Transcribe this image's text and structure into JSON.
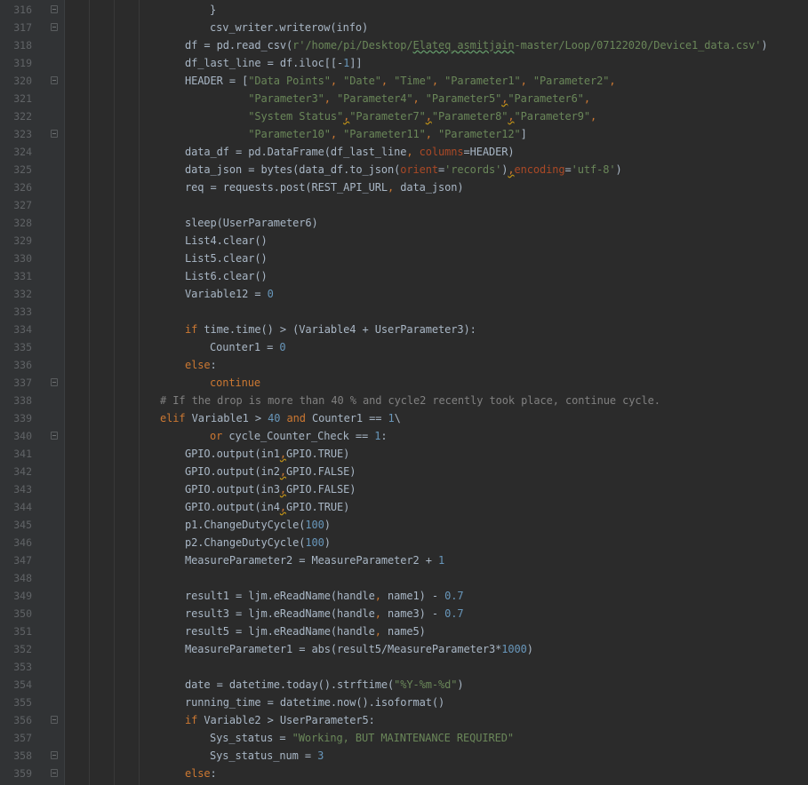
{
  "editor": {
    "language": "python",
    "lines": [
      {
        "n": "316",
        "indent": 2,
        "fold": true,
        "tokens": [
          [
            "}",
            "hl"
          ]
        ]
      },
      {
        "n": "317",
        "indent": 2,
        "fold": true,
        "tokens": [
          [
            "csv_writer.writerow(info)",
            "hl"
          ]
        ]
      },
      {
        "n": "318",
        "indent": 1,
        "fold": false,
        "tokens": [
          [
            "df = pd.read_csv(",
            "hl"
          ],
          [
            "r'/home/pi/Desktop/",
            "str"
          ],
          [
            "Elateq_asmitjain",
            "str typo"
          ],
          [
            "-master/Loop/07122020/Device1_data.csv'",
            "str"
          ],
          [
            ")",
            "hl"
          ]
        ]
      },
      {
        "n": "319",
        "indent": 1,
        "fold": false,
        "tokens": [
          [
            "df_last_line = df.iloc[[-",
            "hl"
          ],
          [
            "1",
            "num"
          ],
          [
            "]]",
            "hl"
          ]
        ]
      },
      {
        "n": "320",
        "indent": 1,
        "fold": true,
        "tokens": [
          [
            "HEADER = [",
            "hl"
          ],
          [
            "\"Data Points\"",
            "str"
          ],
          [
            ", ",
            "kw"
          ],
          [
            "\"Date\"",
            "str"
          ],
          [
            ", ",
            "kw"
          ],
          [
            "\"Time\"",
            "str"
          ],
          [
            ", ",
            "kw"
          ],
          [
            "\"Parameter1\"",
            "str"
          ],
          [
            ", ",
            "kw"
          ],
          [
            "\"Parameter2\"",
            "str"
          ],
          [
            ",",
            "kw"
          ]
        ]
      },
      {
        "n": "321",
        "indent": 1,
        "fold": false,
        "tokens": [
          [
            "          ",
            "hl"
          ],
          [
            "\"Parameter3\"",
            "str"
          ],
          [
            ", ",
            "kw"
          ],
          [
            "\"Parameter4\"",
            "str"
          ],
          [
            ", ",
            "kw"
          ],
          [
            "\"Parameter5\"",
            "str"
          ],
          [
            ",",
            "warn-comma"
          ],
          [
            "\"Parameter6\"",
            "str"
          ],
          [
            ",",
            "kw"
          ]
        ]
      },
      {
        "n": "322",
        "indent": 1,
        "fold": false,
        "tokens": [
          [
            "          ",
            "hl"
          ],
          [
            "\"System Status\"",
            "str"
          ],
          [
            ",",
            "warn-comma"
          ],
          [
            "\"Parameter7\"",
            "str"
          ],
          [
            ",",
            "warn-comma"
          ],
          [
            "\"Parameter8\"",
            "str"
          ],
          [
            ",",
            "warn-comma"
          ],
          [
            "\"Parameter9\"",
            "str"
          ],
          [
            ",",
            "kw"
          ]
        ]
      },
      {
        "n": "323",
        "indent": 1,
        "fold": true,
        "tokens": [
          [
            "          ",
            "hl"
          ],
          [
            "\"Parameter10\"",
            "str"
          ],
          [
            ", ",
            "kw"
          ],
          [
            "\"Parameter11\"",
            "str"
          ],
          [
            ", ",
            "kw"
          ],
          [
            "\"Parameter12\"",
            "str"
          ],
          [
            "]",
            "hl"
          ]
        ]
      },
      {
        "n": "324",
        "indent": 1,
        "fold": false,
        "tokens": [
          [
            "data_df = pd.DataFrame(df_last_line",
            "hl"
          ],
          [
            ", ",
            "kw"
          ],
          [
            "columns",
            "par"
          ],
          [
            "=HEADER)",
            "hl"
          ]
        ]
      },
      {
        "n": "325",
        "indent": 1,
        "fold": false,
        "tokens": [
          [
            "data_json = bytes(data_df.to_json(",
            "hl"
          ],
          [
            "orient",
            "par"
          ],
          [
            "=",
            "hl"
          ],
          [
            "'records'",
            "str"
          ],
          [
            ")",
            "hl"
          ],
          [
            ",",
            "warn-comma"
          ],
          [
            "encoding",
            "par"
          ],
          [
            "=",
            "hl"
          ],
          [
            "'utf-8'",
            "str"
          ],
          [
            ")",
            "hl"
          ]
        ]
      },
      {
        "n": "326",
        "indent": 1,
        "fold": false,
        "tokens": [
          [
            "req = requests.post(REST_API_URL",
            "hl"
          ],
          [
            ", ",
            "kw"
          ],
          [
            "data_json)",
            "hl"
          ]
        ]
      },
      {
        "n": "327",
        "indent": 0,
        "fold": false,
        "tokens": []
      },
      {
        "n": "328",
        "indent": 1,
        "fold": false,
        "tokens": [
          [
            "sleep(UserParameter6)",
            "hl"
          ]
        ]
      },
      {
        "n": "329",
        "indent": 1,
        "fold": false,
        "tokens": [
          [
            "List4.clear()",
            "hl"
          ]
        ]
      },
      {
        "n": "330",
        "indent": 1,
        "fold": false,
        "tokens": [
          [
            "List5.clear()",
            "hl"
          ]
        ]
      },
      {
        "n": "331",
        "indent": 1,
        "fold": false,
        "tokens": [
          [
            "List6.clear()",
            "hl"
          ]
        ]
      },
      {
        "n": "332",
        "indent": 1,
        "fold": false,
        "tokens": [
          [
            "Variable12 = ",
            "hl"
          ],
          [
            "0",
            "num"
          ]
        ]
      },
      {
        "n": "333",
        "indent": 0,
        "fold": false,
        "tokens": []
      },
      {
        "n": "334",
        "indent": 1,
        "fold": false,
        "tokens": [
          [
            "if ",
            "kw"
          ],
          [
            "time.time() > (Variable4 + UserParameter3):",
            "hl"
          ]
        ]
      },
      {
        "n": "335",
        "indent": 2,
        "fold": false,
        "tokens": [
          [
            "Counter1 = ",
            "hl"
          ],
          [
            "0",
            "num"
          ]
        ]
      },
      {
        "n": "336",
        "indent": 1,
        "fold": false,
        "tokens": [
          [
            "else",
            "kw"
          ],
          [
            ":",
            "hl"
          ]
        ]
      },
      {
        "n": "337",
        "indent": 2,
        "fold": true,
        "tokens": [
          [
            "continue",
            "kw"
          ]
        ]
      },
      {
        "n": "338",
        "indent": 0,
        "fold": false,
        "tokens": [
          [
            "# If the drop is more than 40 % and cycle2 recently took place, continue cycle.",
            "cm"
          ]
        ]
      },
      {
        "n": "339",
        "indent": 0,
        "fold": false,
        "tokens": [
          [
            "elif ",
            "kw"
          ],
          [
            "Variable1 > ",
            "hl"
          ],
          [
            "40 ",
            "num"
          ],
          [
            "and ",
            "kw"
          ],
          [
            "Counter1 == ",
            "hl"
          ],
          [
            "1",
            "num"
          ],
          [
            "\\",
            "hl"
          ]
        ]
      },
      {
        "n": "340",
        "indent": 2,
        "fold": true,
        "tokens": [
          [
            "or ",
            "kw"
          ],
          [
            "cycle_Counter_Check == ",
            "hl"
          ],
          [
            "1",
            "num"
          ],
          [
            ":",
            "hl"
          ]
        ]
      },
      {
        "n": "341",
        "indent": 1,
        "fold": false,
        "tokens": [
          [
            "GPIO.output(in1",
            "hl"
          ],
          [
            ",",
            "warn-comma"
          ],
          [
            "GPIO.TRUE)",
            "hl"
          ]
        ]
      },
      {
        "n": "342",
        "indent": 1,
        "fold": false,
        "tokens": [
          [
            "GPIO.output(in2",
            "hl"
          ],
          [
            ",",
            "warn-comma"
          ],
          [
            "GPIO.FALSE)",
            "hl"
          ]
        ]
      },
      {
        "n": "343",
        "indent": 1,
        "fold": false,
        "tokens": [
          [
            "GPIO.output(in3",
            "hl"
          ],
          [
            ",",
            "warn-comma"
          ],
          [
            "GPIO.FALSE)",
            "hl"
          ]
        ]
      },
      {
        "n": "344",
        "indent": 1,
        "fold": false,
        "tokens": [
          [
            "GPIO.output(in4",
            "hl"
          ],
          [
            ",",
            "warn-comma"
          ],
          [
            "GPIO.TRUE)",
            "hl"
          ]
        ]
      },
      {
        "n": "345",
        "indent": 1,
        "fold": false,
        "tokens": [
          [
            "p1.ChangeDutyCycle(",
            "hl"
          ],
          [
            "100",
            "num"
          ],
          [
            ")",
            "hl"
          ]
        ]
      },
      {
        "n": "346",
        "indent": 1,
        "fold": false,
        "tokens": [
          [
            "p2.ChangeDutyCycle(",
            "hl"
          ],
          [
            "100",
            "num"
          ],
          [
            ")",
            "hl"
          ]
        ]
      },
      {
        "n": "347",
        "indent": 1,
        "fold": false,
        "tokens": [
          [
            "MeasureParameter2 = MeasureParameter2 + ",
            "hl"
          ],
          [
            "1",
            "num"
          ]
        ]
      },
      {
        "n": "348",
        "indent": 0,
        "fold": false,
        "tokens": []
      },
      {
        "n": "349",
        "indent": 1,
        "fold": false,
        "tokens": [
          [
            "result1 = ljm.eReadName(handle",
            "hl"
          ],
          [
            ", ",
            "kw"
          ],
          [
            "name1) - ",
            "hl"
          ],
          [
            "0.7",
            "num"
          ]
        ]
      },
      {
        "n": "350",
        "indent": 1,
        "fold": false,
        "tokens": [
          [
            "result3 = ljm.eReadName(handle",
            "hl"
          ],
          [
            ", ",
            "kw"
          ],
          [
            "name3) - ",
            "hl"
          ],
          [
            "0.7",
            "num"
          ]
        ]
      },
      {
        "n": "351",
        "indent": 1,
        "fold": false,
        "tokens": [
          [
            "result5 = ljm.eReadName(handle",
            "hl"
          ],
          [
            ", ",
            "kw"
          ],
          [
            "name5)",
            "hl"
          ]
        ]
      },
      {
        "n": "352",
        "indent": 1,
        "fold": false,
        "tokens": [
          [
            "MeasureParameter1 = abs(result5/MeasureParameter3*",
            "hl"
          ],
          [
            "1000",
            "num"
          ],
          [
            ")",
            "hl"
          ]
        ]
      },
      {
        "n": "353",
        "indent": 0,
        "fold": false,
        "tokens": []
      },
      {
        "n": "354",
        "indent": 1,
        "fold": false,
        "tokens": [
          [
            "date = datetime.today().strftime(",
            "hl"
          ],
          [
            "\"%Y-%m-%d\"",
            "str"
          ],
          [
            ")",
            "hl"
          ]
        ]
      },
      {
        "n": "355",
        "indent": 1,
        "fold": false,
        "tokens": [
          [
            "running_time = datetime.now().isoformat()",
            "hl"
          ]
        ]
      },
      {
        "n": "356",
        "indent": 1,
        "fold": true,
        "tokens": [
          [
            "if ",
            "kw"
          ],
          [
            "Variable2 > UserParameter5:",
            "hl"
          ]
        ]
      },
      {
        "n": "357",
        "indent": 2,
        "fold": false,
        "tokens": [
          [
            "Sys_status = ",
            "hl"
          ],
          [
            "\"Working, BUT MAINTENANCE REQUIRED\"",
            "str"
          ]
        ]
      },
      {
        "n": "358",
        "indent": 2,
        "fold": true,
        "tokens": [
          [
            "Sys_status_num = ",
            "hl"
          ],
          [
            "3",
            "num"
          ]
        ]
      },
      {
        "n": "359",
        "indent": 1,
        "fold": true,
        "tokens": [
          [
            "else",
            "kw"
          ],
          [
            ":",
            "hl"
          ]
        ]
      }
    ]
  },
  "colors": {
    "background": "#2b2b2b",
    "gutter": "#313335",
    "line_number": "#606366",
    "default_text": "#a9b7c6",
    "keyword": "#cc7832",
    "string": "#6a8759",
    "number": "#6897bb",
    "comment": "#808080",
    "named_parameter": "#aa4926"
  }
}
